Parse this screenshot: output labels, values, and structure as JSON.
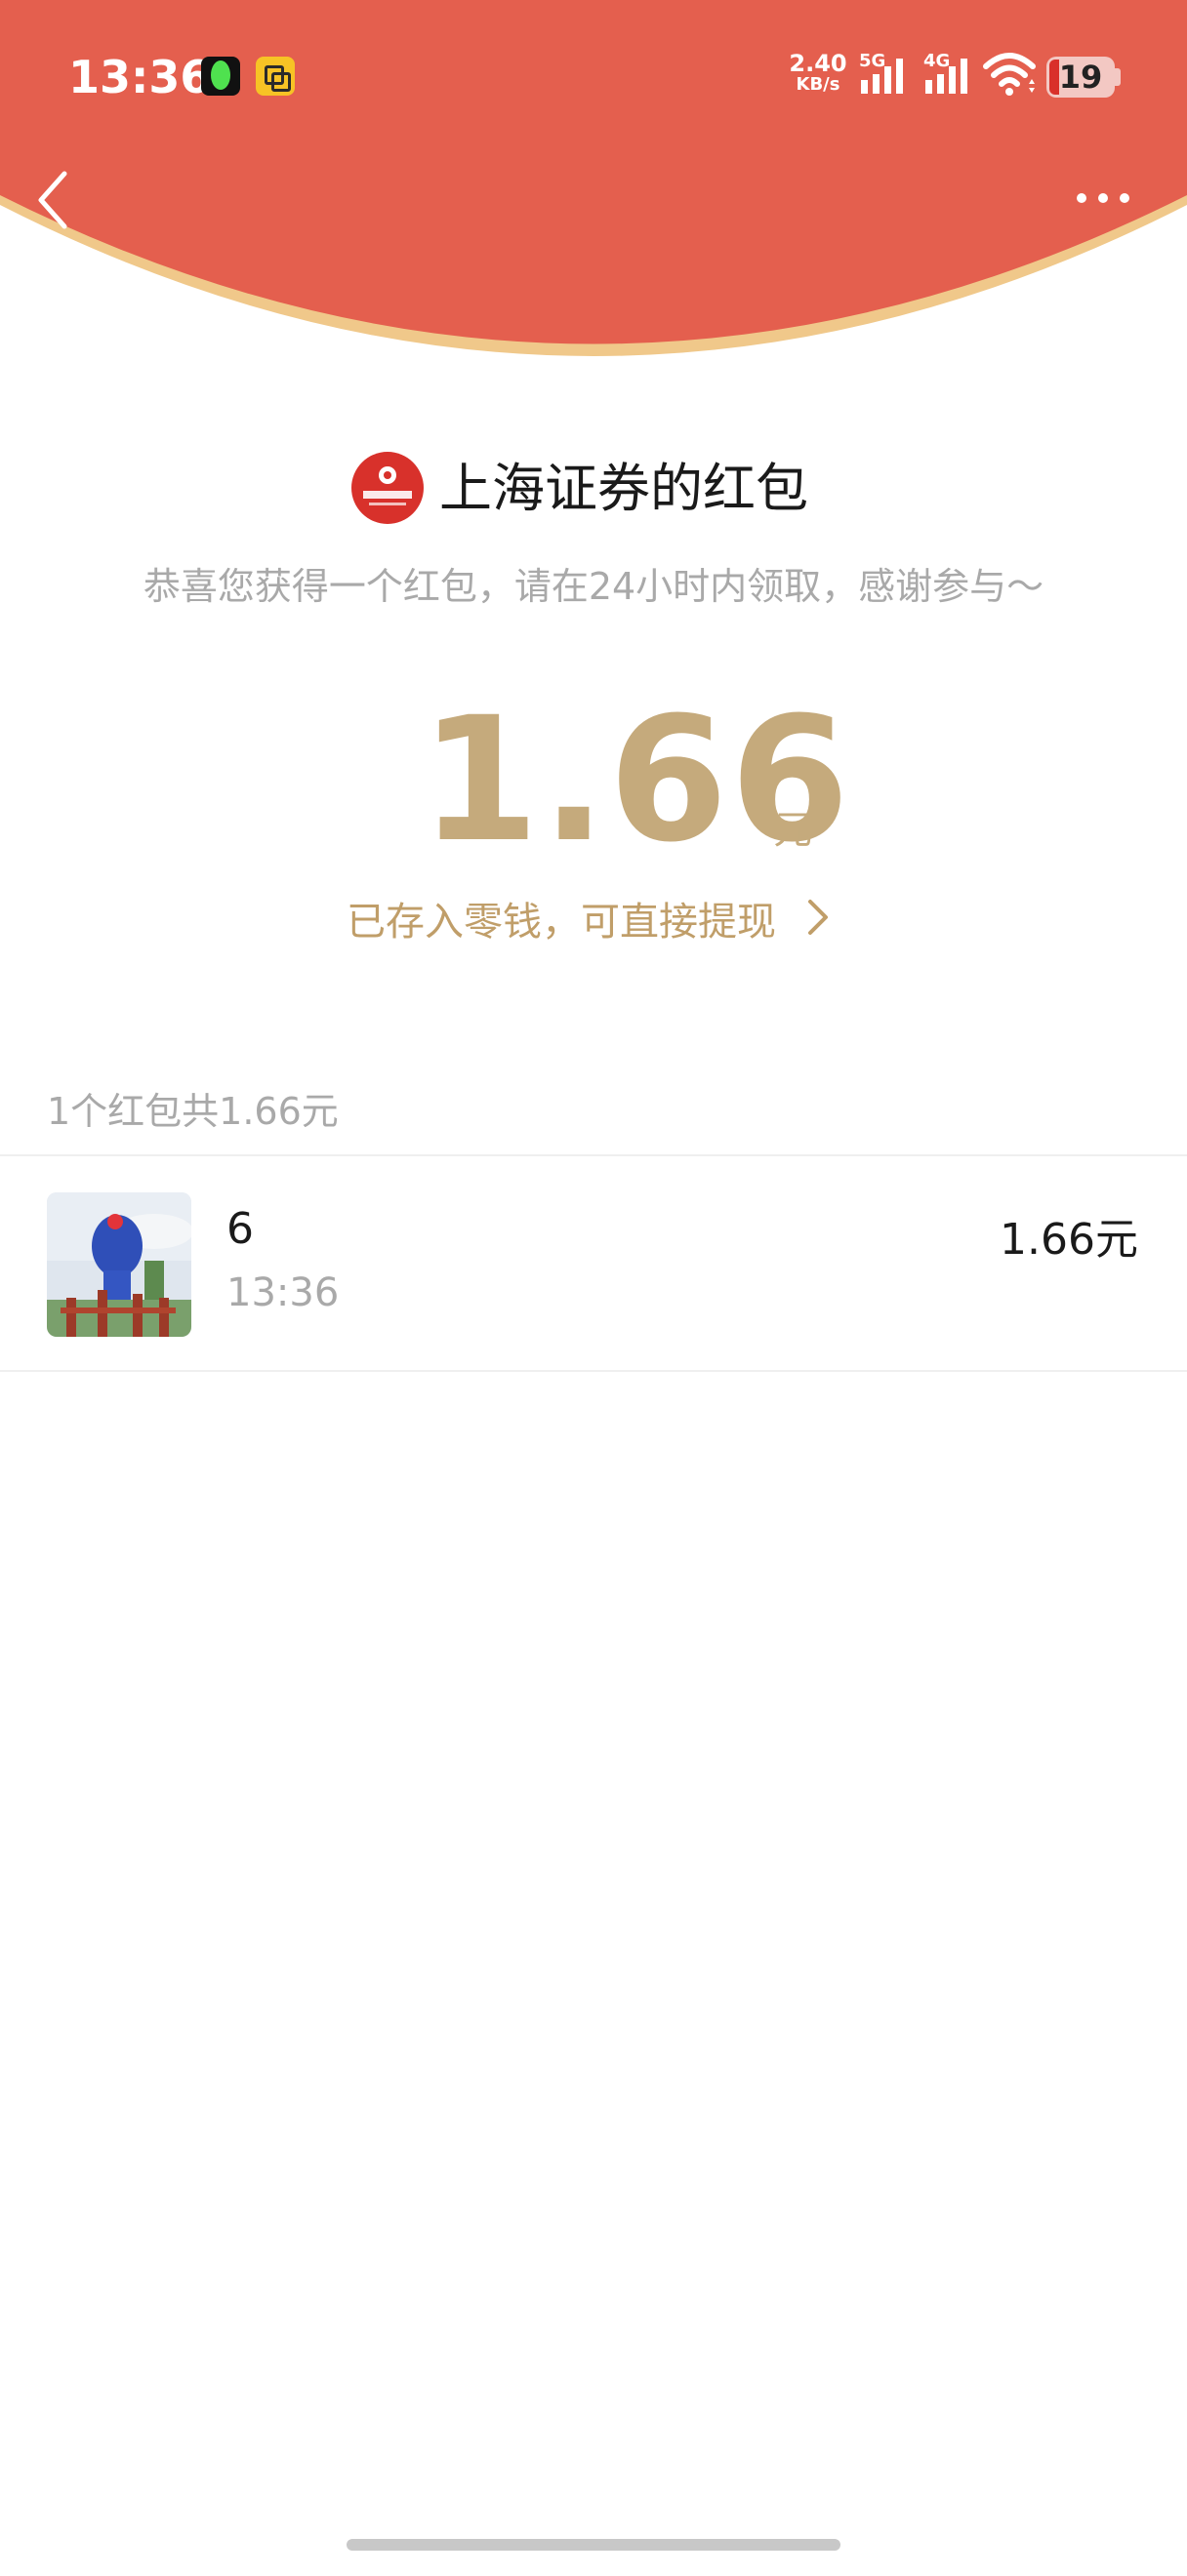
{
  "status_bar": {
    "time": "13:36",
    "net_speed_value": "2.40",
    "net_speed_unit": "KB/s",
    "sim1_label": "5G",
    "sim2_label": "4G",
    "battery_level": "19"
  },
  "header": {
    "color": "#e45f4e",
    "rim_color": "#f0c88a"
  },
  "main": {
    "title": "上海证券的红包",
    "subtitle": "恭喜您获得一个红包，请在24小时内领取，感谢参与～",
    "amount": "1.66",
    "amount_unit": "元",
    "withdraw_text": "已存入零钱，可直接提现",
    "accent_color": "#c5aa7c"
  },
  "list": {
    "summary": "1个红包共1.66元",
    "items": [
      {
        "name": "6",
        "time": "13:36",
        "amount": "1.66元"
      }
    ]
  }
}
